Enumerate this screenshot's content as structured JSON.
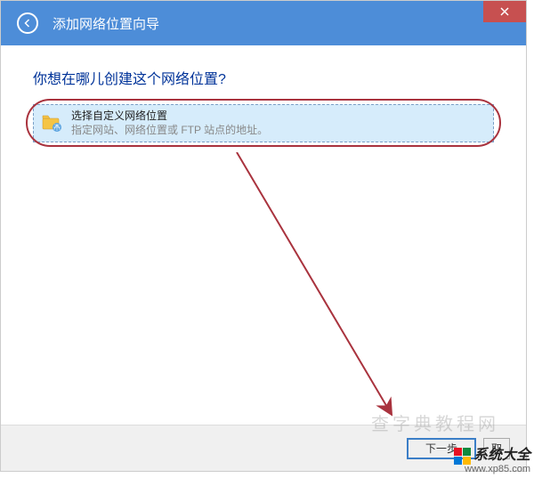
{
  "window": {
    "title": "添加网络位置向导"
  },
  "content": {
    "question": "你想在哪儿创建这个网络位置?",
    "option": {
      "title": "选择自定义网络位置",
      "desc": "指定网站、网络位置或 FTP 站点的地址。"
    }
  },
  "footer": {
    "next_label": "下一步",
    "cancel_partial": "取"
  },
  "watermark": {
    "brand": "系统大全",
    "url": "www.xp85.com",
    "faint": "查字典教程网"
  },
  "colors": {
    "win_blue": "#0078d7",
    "win_green": "#10893e",
    "win_yellow": "#ffb900",
    "win_red": "#e81123"
  }
}
